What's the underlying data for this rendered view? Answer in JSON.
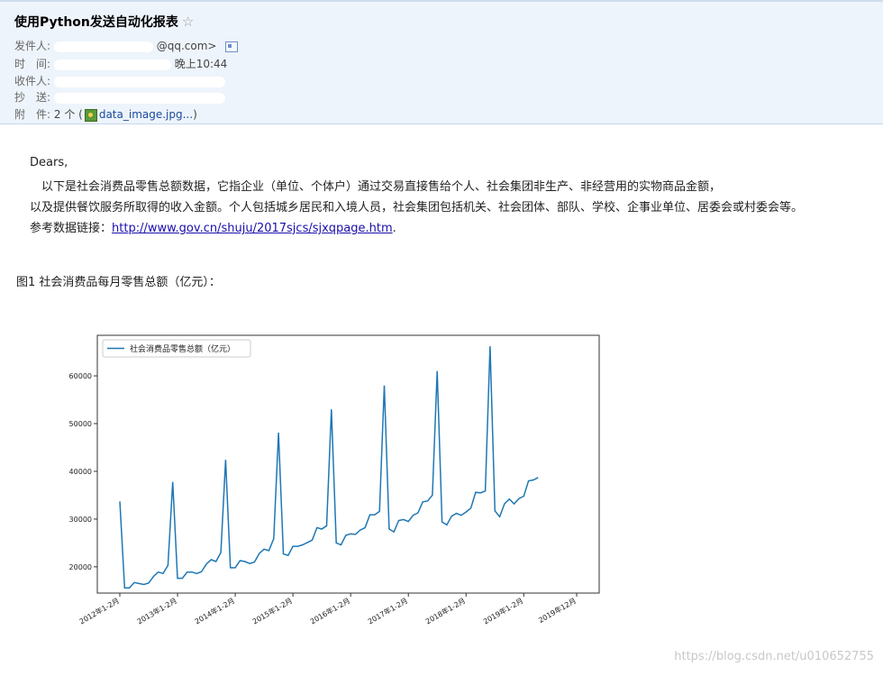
{
  "email": {
    "subject": "使用Python发送自动化报表",
    "star_icon": "☆",
    "from_label": "发件人:",
    "from_value": "@qq.com>",
    "time_label": "时　间:",
    "time_value": "晚上10:44",
    "to_label": "收件人:",
    "cc_label": "抄　送:",
    "attach_label": "附　件:",
    "attach_count": "2 个 (",
    "attach_name": "data_image.jpg...",
    "attach_close": ")"
  },
  "body": {
    "greeting": "Dears,",
    "line1": "　以下是社会消费品零售总额数据，它指企业（单位、个体户）通过交易直接售给个人、社会集团非生产、非经营用的实物商品金额，",
    "line2": "以及提供餐饮服务所取得的收入金额。个人包括城乡居民和入境人员，社会集团包括机关、社会团体、部队、学校、企事业单位、居委会或村委会等。",
    "ref_label": "参考数据链接：",
    "ref_link": "http://www.gov.cn/shuju/2017sjcs/sjxqpage.htm",
    "ref_end": ".",
    "fig_caption": "图1 社会消费品每月零售总额（亿元）："
  },
  "chart_data": {
    "type": "line",
    "legend": "社会消费品零售总额（亿元）",
    "legend_position": "upper-left",
    "color": "#1f77b4",
    "xlim_months": [
      0,
      95
    ],
    "ylim": [
      14500,
      68500
    ],
    "yticks": [
      20000,
      30000,
      40000,
      50000,
      60000
    ],
    "xtick_labels": [
      "2012年1-2月",
      "2013年1-2月",
      "2014年1-2月",
      "2015年1-2月",
      "2016年1-2月",
      "2017年1-2月",
      "2018年1-2月",
      "2019年1-2月",
      "2019年12月"
    ],
    "xtick_months": [
      0,
      12,
      24,
      36,
      48,
      60,
      72,
      84,
      95
    ],
    "x_months": [
      0,
      1,
      2,
      3,
      4,
      5,
      6,
      7,
      8,
      9,
      10,
      11,
      12,
      13,
      14,
      15,
      16,
      17,
      18,
      19,
      20,
      21,
      22,
      23,
      24,
      25,
      26,
      27,
      28,
      29,
      30,
      31,
      32,
      33,
      34,
      35,
      36,
      37,
      38,
      39,
      40,
      41,
      42,
      43,
      44,
      45,
      46,
      47,
      48,
      49,
      50,
      51,
      52,
      53,
      54,
      55,
      56,
      57,
      58,
      59,
      60,
      61,
      62,
      63,
      64,
      65,
      66,
      67,
      68,
      69,
      70,
      71,
      72,
      73,
      74,
      75,
      76,
      77,
      78,
      79,
      80,
      81,
      82,
      83,
      84,
      85,
      86,
      87,
      88,
      89,
      90,
      91,
      92,
      93,
      94,
      95
    ],
    "values": [
      33700,
      15600,
      15600,
      16700,
      16500,
      16300,
      16600,
      18000,
      18900,
      18600,
      20300,
      37800,
      17600,
      17600,
      18900,
      18900,
      18600,
      19000,
      20600,
      21500,
      21100,
      23000,
      42400,
      19800,
      19800,
      21300,
      21100,
      20700,
      21000,
      22800,
      23700,
      23400,
      25900,
      48100,
      22700,
      22400,
      24300,
      24300,
      24600,
      25100,
      25600,
      28200,
      27900,
      28600,
      53000,
      25000,
      24600,
      26600,
      26900,
      26800,
      27700,
      28200,
      30900,
      30900,
      31600,
      58000,
      27900,
      27300,
      29700,
      29900,
      29500,
      30800,
      31300,
      33600,
      33800,
      35000,
      61000,
      29400,
      28800,
      30600,
      31200,
      30800,
      31500,
      32300,
      35600,
      35500,
      35900,
      66200,
      31700,
      30500,
      33200,
      34200,
      33200,
      34300,
      34800,
      38000,
      38200,
      38700
    ]
  },
  "watermark": "https://blog.csdn.net/u010652755"
}
